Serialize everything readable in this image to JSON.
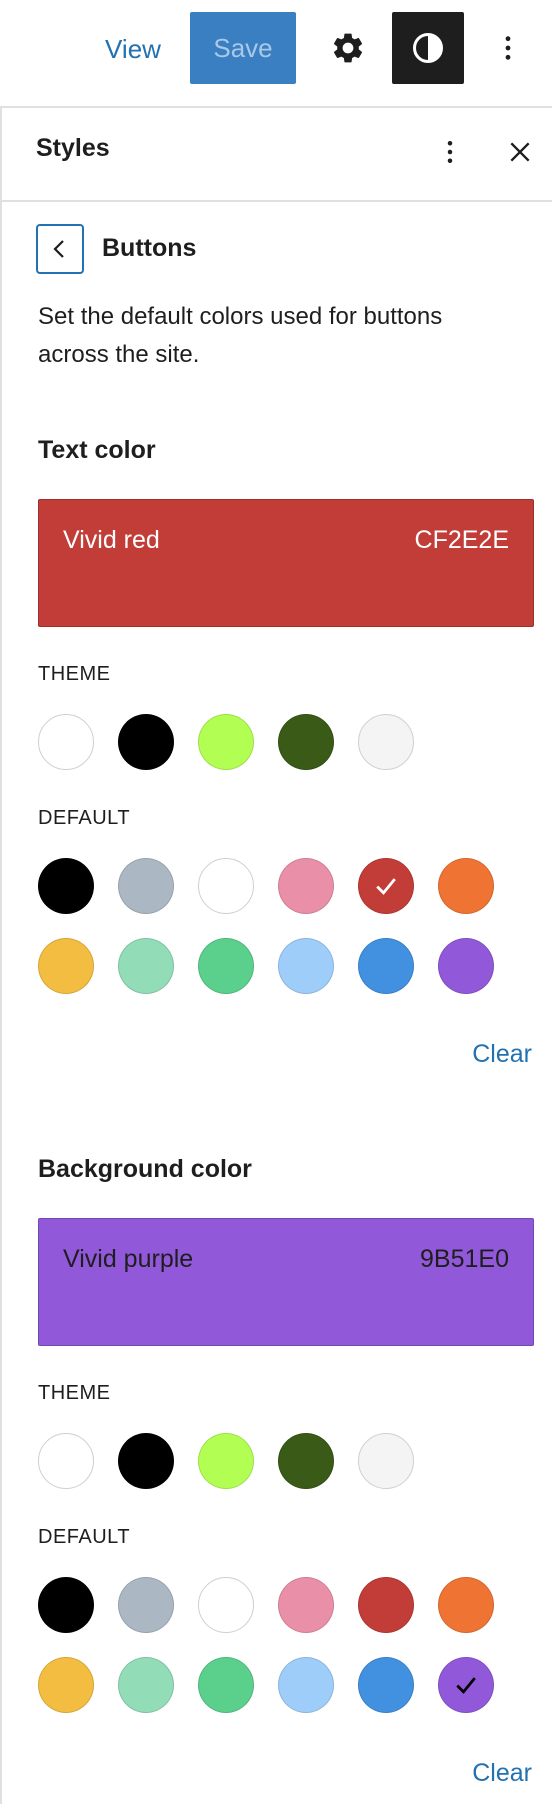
{
  "toolbar": {
    "view_label": "View",
    "save_label": "Save"
  },
  "panel": {
    "title": "Styles"
  },
  "buttons_screen": {
    "title": "Buttons",
    "description": "Set the default colors used for buttons across the site."
  },
  "text_color": {
    "heading": "Text color",
    "selected_name": "Vivid red",
    "selected_hex": "CF2E2E",
    "selected_color": "#c33d38",
    "theme_label": "THEME",
    "default_label": "DEFAULT",
    "clear_label": "Clear",
    "selected_default_index": 4
  },
  "background_color": {
    "heading": "Background color",
    "selected_name": "Vivid purple",
    "selected_hex": "9B51E0",
    "selected_color": "#9159d9",
    "theme_label": "THEME",
    "default_label": "DEFAULT",
    "clear_label": "Clear",
    "selected_default_index": 11
  },
  "theme_colors": [
    "#ffffff",
    "#000000",
    "#b2fe52",
    "#3a5a17",
    "#f4f4f4"
  ],
  "default_colors": [
    "#000000",
    "#abb8c3",
    "#ffffff",
    "#ea8fa8",
    "#c33d38",
    "#ef7434",
    "#f2bd40",
    "#92dcb8",
    "#5bcf8c",
    "#9fcdfa",
    "#4290e0",
    "#9159d9"
  ],
  "icons": {
    "gear": "gear-icon",
    "styles": "half-circle-icon",
    "options": "more-vertical-icon",
    "close": "close-icon",
    "back": "chevron-left-icon",
    "check": "check-icon"
  }
}
